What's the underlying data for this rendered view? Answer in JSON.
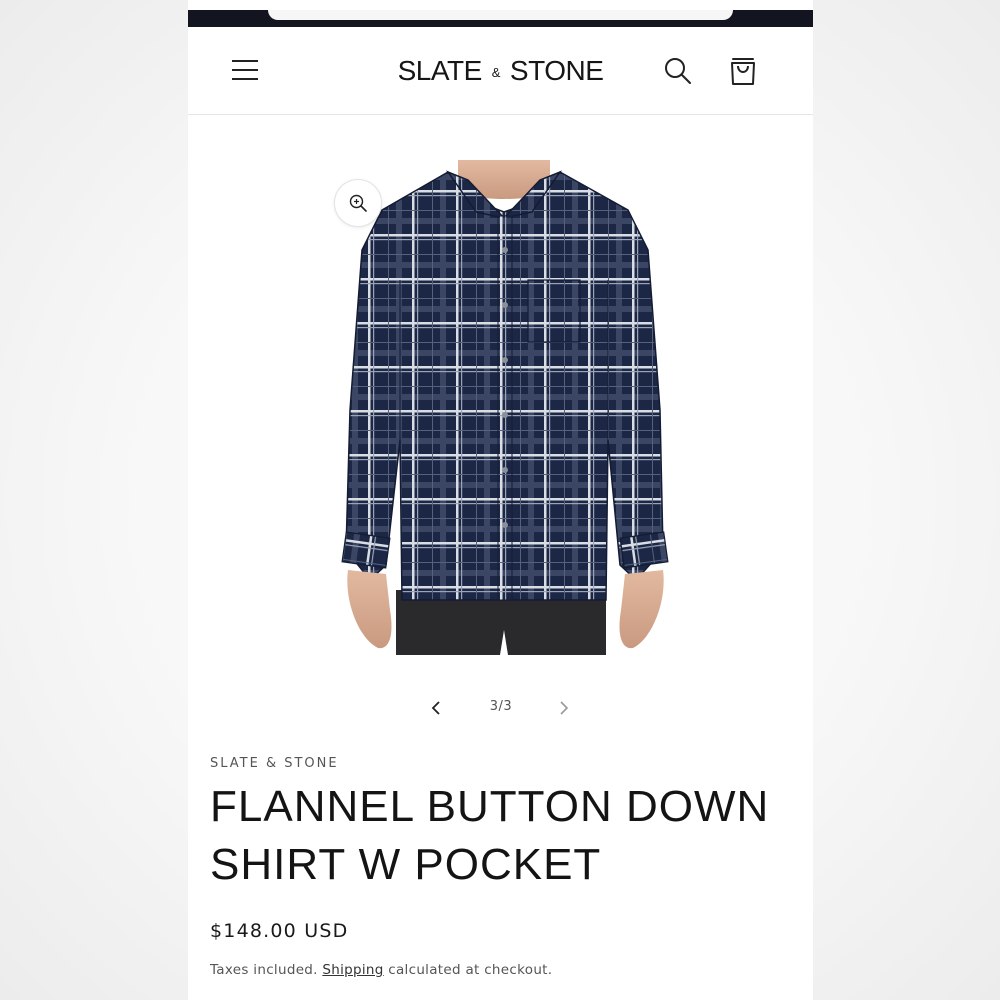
{
  "header": {
    "logo_left": "SLATE",
    "logo_amp": "&",
    "logo_right": "STONE",
    "menu_icon": "hamburger-menu-icon",
    "search_icon": "search-icon",
    "cart_icon": "cart-bag-icon"
  },
  "gallery": {
    "zoom_icon": "zoom-in-icon",
    "image_subject": "navy plaid flannel button down shirt",
    "current": "3/3"
  },
  "product": {
    "vendor": "SLATE & STONE",
    "title": "FLANNEL BUTTON DOWN SHIRT W POCKET",
    "price": "$148.00 USD",
    "tax_prefix": "Taxes included.",
    "shipping_link": "Shipping",
    "tax_suffix": "calculated at checkout."
  },
  "colors": {
    "topbar": "#121420",
    "shirt_navy": "#1c2745",
    "plaid_light": "#d9dde4"
  }
}
